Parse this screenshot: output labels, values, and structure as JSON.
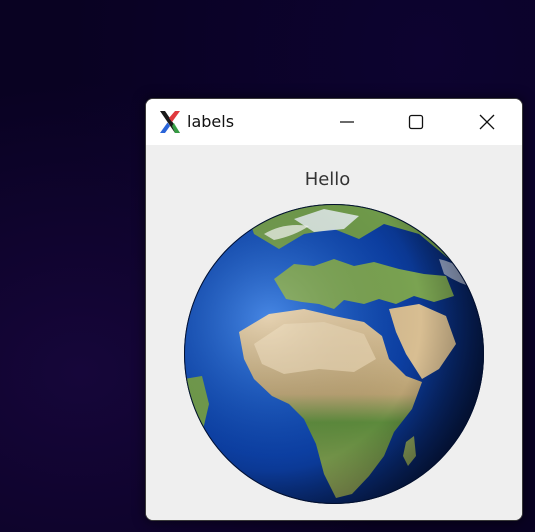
{
  "window": {
    "title": "labels",
    "controls": {
      "minimize": "minimize-icon",
      "maximize": "maximize-icon",
      "close": "close-icon"
    }
  },
  "content": {
    "label_text": "Hello",
    "image": "earth-globe"
  },
  "colors": {
    "titlebar": "#ffffff",
    "content_bg": "#efefef",
    "desktop_bg": "#090222",
    "ocean": "#0b3fa8",
    "land": "#6f9a4a",
    "desert": "#d9c09a"
  }
}
